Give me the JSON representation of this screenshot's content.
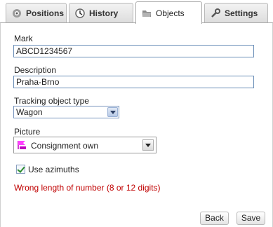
{
  "tabs": [
    {
      "label": "Positions",
      "icon": "positions-icon",
      "active": false
    },
    {
      "label": "History",
      "icon": "history-icon",
      "active": false
    },
    {
      "label": "Objects",
      "icon": "objects-icon",
      "active": true
    },
    {
      "label": "Settings",
      "icon": "settings-icon",
      "active": false
    }
  ],
  "form": {
    "mark_label": "Mark",
    "mark_value": "ABCD1234567",
    "description_label": "Description",
    "description_value": "Praha-Brno",
    "type_label": "Tracking object type",
    "type_value": "Wagon",
    "picture_label": "Picture",
    "picture_value": "Consignment own",
    "azimuths_label": "Use azimuths",
    "azimuths_checked": true,
    "error_text": "Wrong length of number (8 or 12 digits)"
  },
  "buttons": {
    "back_label": "Back",
    "save_label": "Save"
  },
  "colors": {
    "error": "#c00000",
    "input_border": "#6b8fb8"
  }
}
